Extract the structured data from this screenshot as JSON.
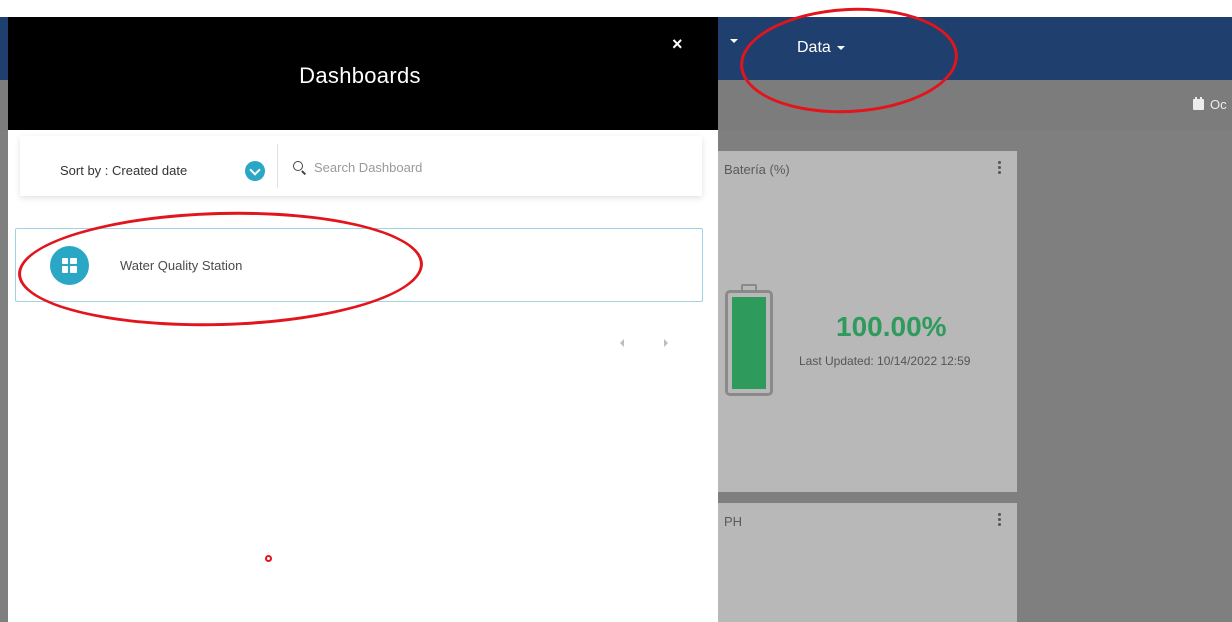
{
  "navbar": {
    "prev_item_label": "",
    "data_label": "Data"
  },
  "subbar": {
    "date_label": "Oc"
  },
  "widgets": {
    "battery": {
      "title": "Batería (%)",
      "value": "100.00%",
      "updated": "Last Updated: 10/14/2022 12:59",
      "level_fraction": 1.0,
      "color": "#2e9a5c"
    },
    "ph": {
      "title": "PH"
    }
  },
  "panel": {
    "title": "Dashboards",
    "close_icon": "×",
    "sort_label": "Sort by : Created date",
    "search_placeholder": "Search Dashboard",
    "items": [
      {
        "name": "Water Quality Station",
        "icon": "dashboard-grid-icon"
      }
    ],
    "accent_color": "#2aa7c4"
  },
  "annotations": {
    "color": "#e2141c"
  }
}
